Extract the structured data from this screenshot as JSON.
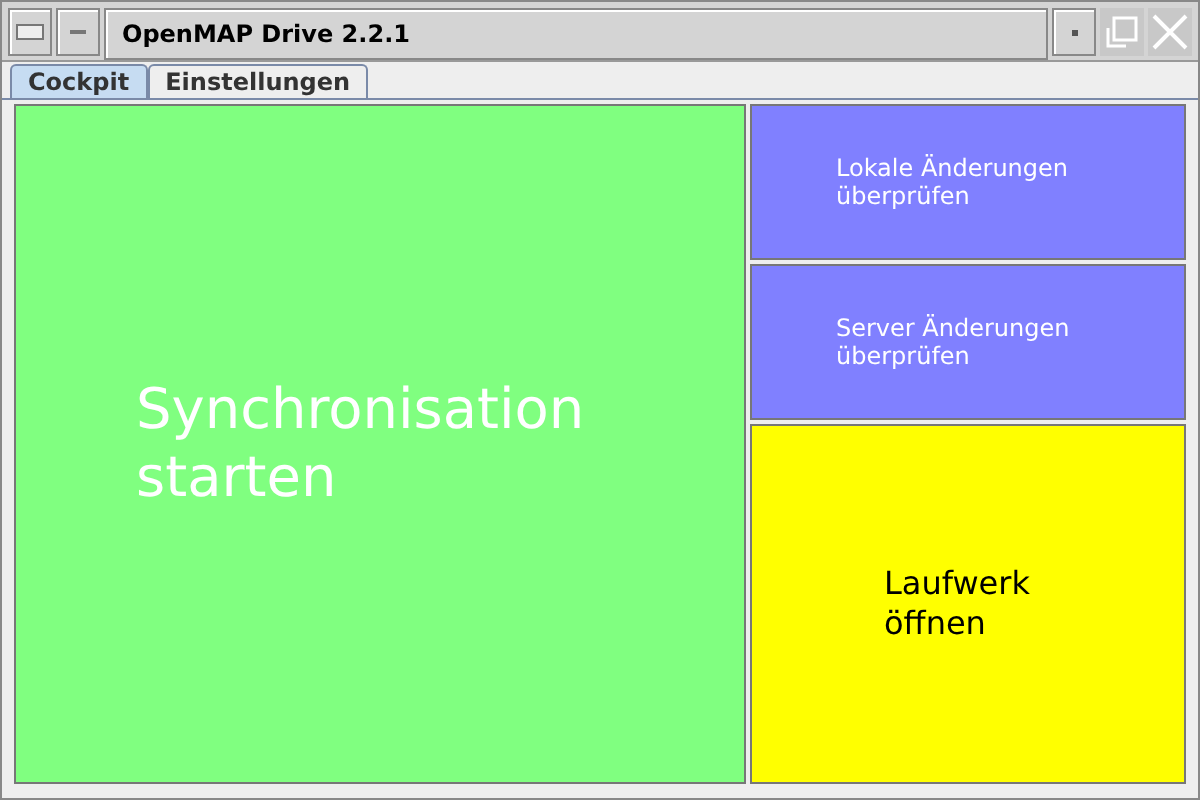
{
  "window": {
    "title": "OpenMAP Drive 2.2.1"
  },
  "tabs": [
    {
      "label": "Cockpit",
      "selected": true
    },
    {
      "label": "Einstellungen",
      "selected": false
    }
  ],
  "main_button": {
    "label": "Synchronisation\nstarten",
    "color": "#80ff80"
  },
  "side_buttons": [
    {
      "label": "Lokale Änderungen\nüberprüfen",
      "color": "#8080ff",
      "kind": "small"
    },
    {
      "label": "Server Änderungen\nüberprüfen",
      "color": "#8080ff",
      "kind": "small"
    },
    {
      "label": "Laufwerk\nöffnen",
      "color": "#ffff00",
      "kind": "large"
    }
  ]
}
